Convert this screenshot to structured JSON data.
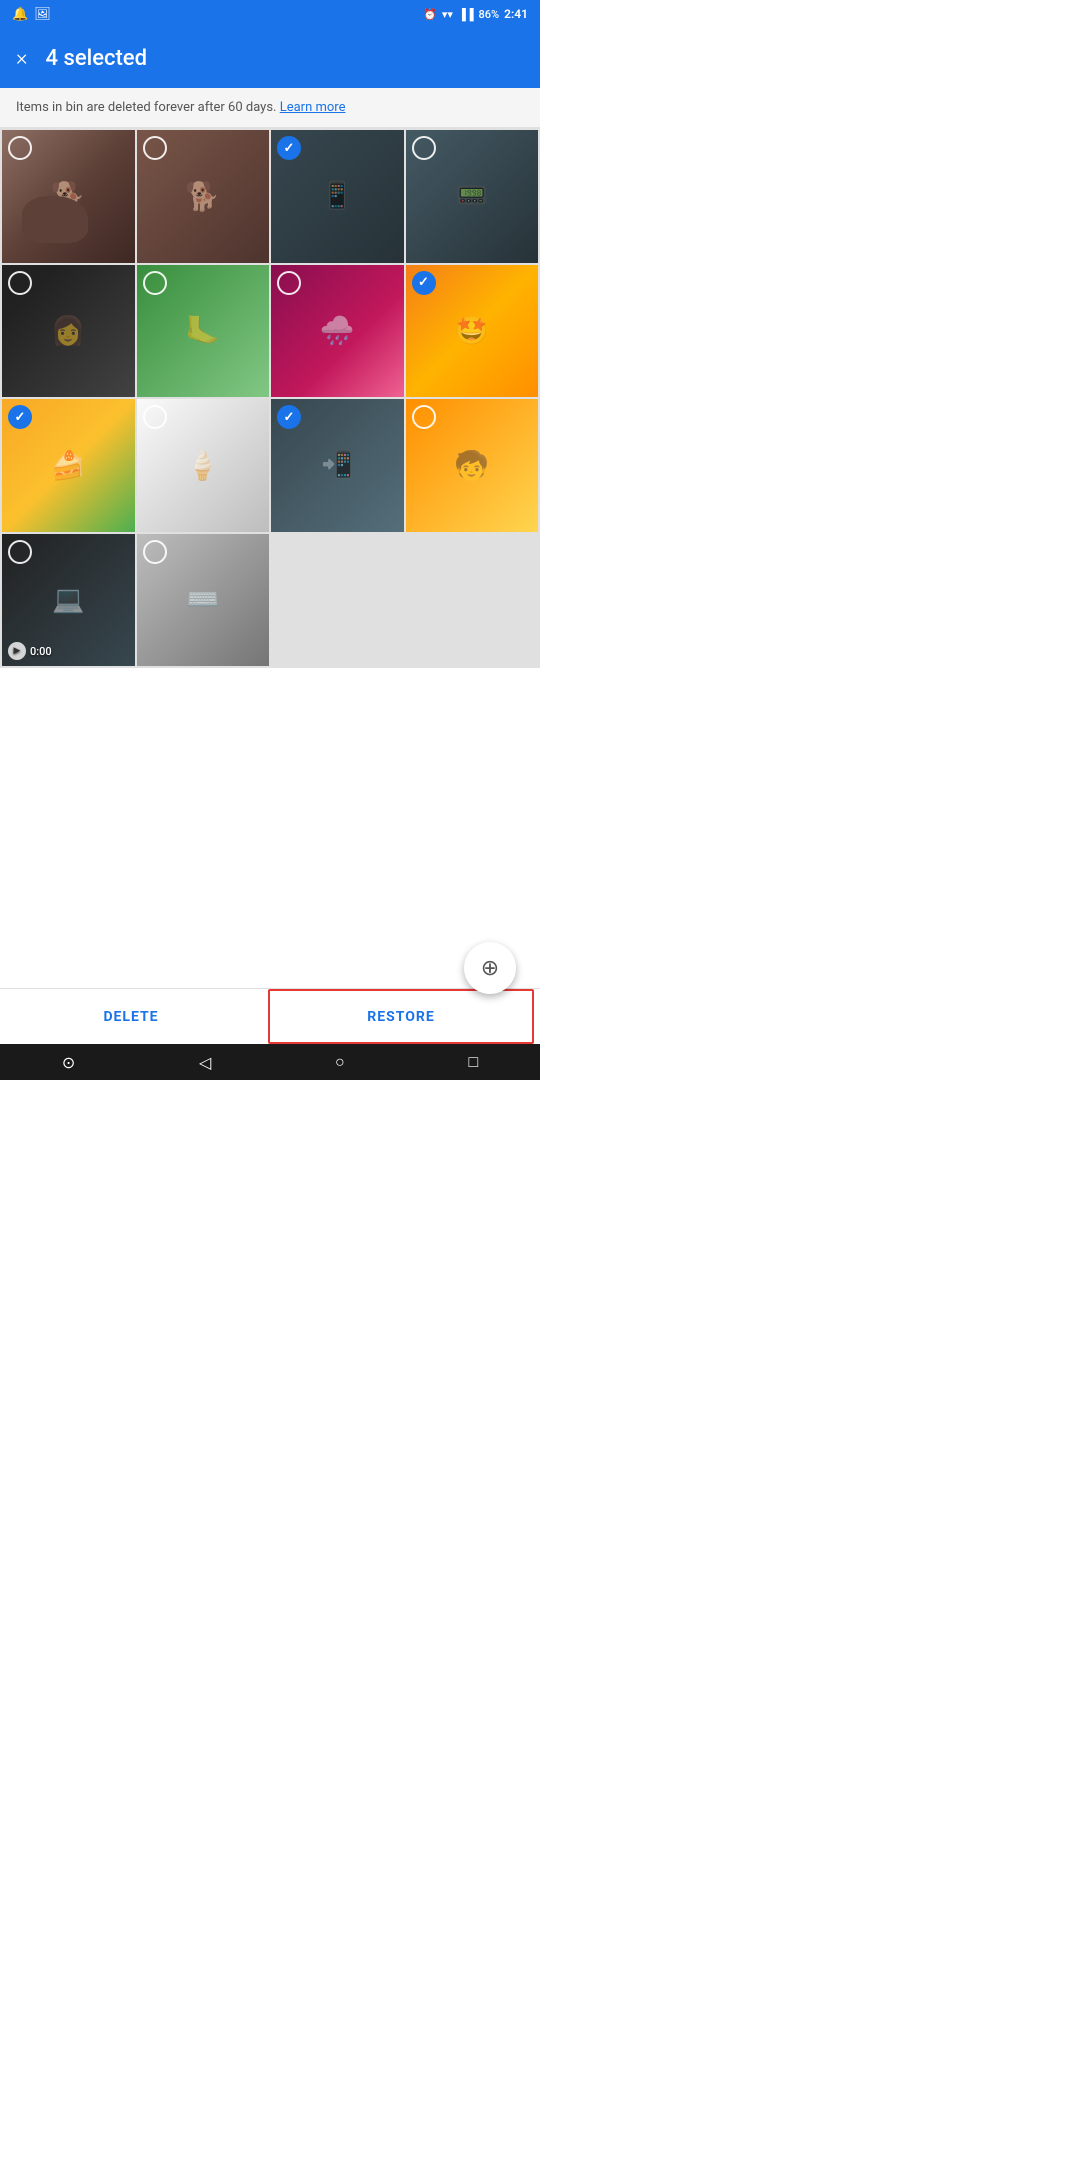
{
  "statusBar": {
    "leftIcons": [
      "bell-icon",
      "image-icon"
    ],
    "rightItems": {
      "battery": "86%",
      "time": "2:41"
    }
  },
  "topBar": {
    "closeLabel": "×",
    "selectionCount": "4 selected"
  },
  "infoBanner": {
    "text": "Items in bin are deleted forever after 60 days.",
    "linkText": "Learn more"
  },
  "photos": [
    {
      "id": 1,
      "checked": false,
      "colorClass": "photo-1",
      "contentClass": "content-dog",
      "isVideo": false
    },
    {
      "id": 2,
      "checked": false,
      "colorClass": "photo-2",
      "contentClass": "content-dog",
      "isVideo": false
    },
    {
      "id": 3,
      "checked": true,
      "colorClass": "photo-3",
      "contentClass": "content-screen",
      "isVideo": false
    },
    {
      "id": 4,
      "checked": false,
      "colorClass": "photo-4",
      "contentClass": "content-tablet",
      "isVideo": false
    },
    {
      "id": 5,
      "checked": false,
      "colorClass": "photo-5",
      "contentClass": "content-woman",
      "isVideo": false
    },
    {
      "id": 6,
      "checked": false,
      "colorClass": "photo-6",
      "contentClass": "content-feet",
      "isVideo": false
    },
    {
      "id": 7,
      "checked": false,
      "colorClass": "photo-7",
      "contentClass": "content-rain",
      "isVideo": false
    },
    {
      "id": 8,
      "checked": true,
      "colorClass": "photo-8",
      "contentClass": "content-paint",
      "isVideo": false
    },
    {
      "id": 9,
      "checked": true,
      "colorClass": "photo-9",
      "contentClass": "content-food",
      "isVideo": false
    },
    {
      "id": 10,
      "checked": false,
      "colorClass": "photo-10",
      "contentClass": "content-icecream",
      "isVideo": false
    },
    {
      "id": 11,
      "checked": true,
      "colorClass": "photo-11",
      "contentClass": "content-phone",
      "isVideo": false
    },
    {
      "id": 12,
      "checked": false,
      "colorClass": "photo-12",
      "contentClass": "content-boy",
      "isVideo": false
    },
    {
      "id": 13,
      "checked": false,
      "colorClass": "photo-13",
      "contentClass": "content-laptop",
      "isVideo": true,
      "videoDuration": "0:00"
    },
    {
      "id": 14,
      "checked": false,
      "colorClass": "photo-14",
      "contentClass": "content-keyboard",
      "isVideo": false
    }
  ],
  "bottomBar": {
    "deleteLabel": "DELETE",
    "restoreLabel": "RESTORE"
  },
  "fab": {
    "icon": "⊕"
  },
  "navBar": {
    "icons": [
      "⊙",
      "◁",
      "○",
      "□"
    ]
  }
}
